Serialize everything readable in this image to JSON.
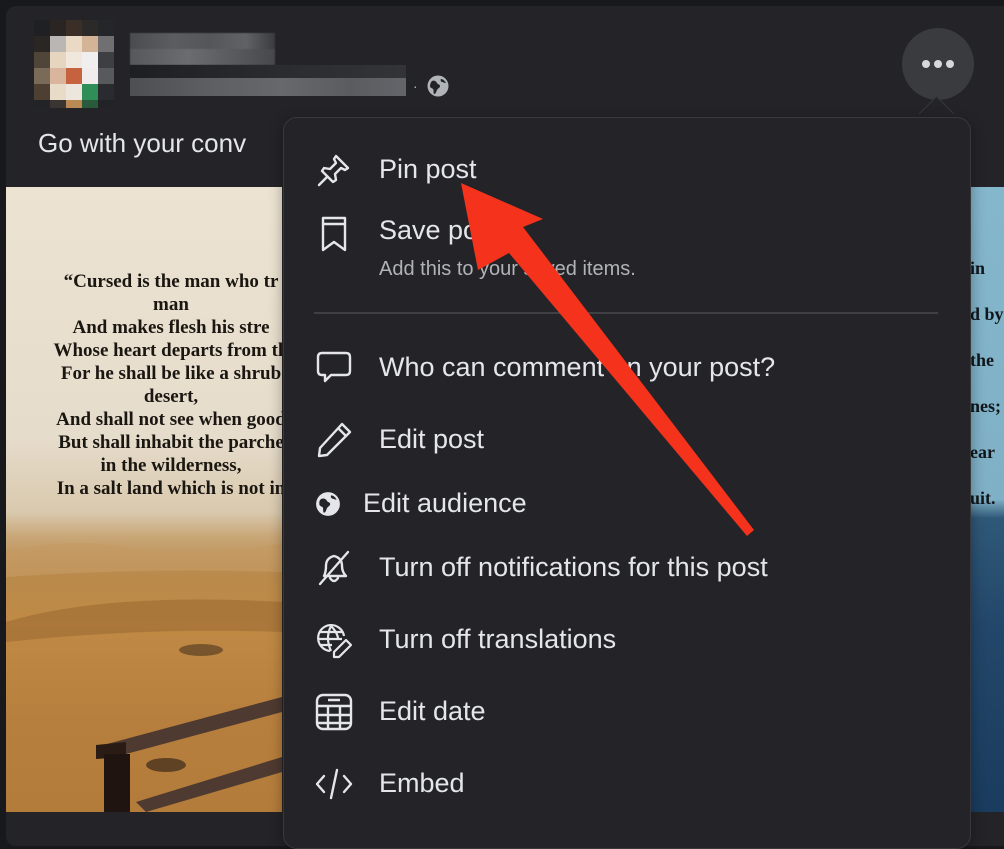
{
  "post": {
    "author_name": "[redacted name]",
    "privacy_icon": "globe-icon",
    "text_visible": "Go with your conv",
    "more_button_icon": "more-horizontal-icon"
  },
  "photo_left": {
    "poem_lines": [
      "“Cursed is the man who tr",
      "man",
      "And makes flesh his stre",
      "Whose heart departs from th",
      "For he shall be like a shrub",
      "desert,",
      "And shall not see when good",
      "But shall inhabit the parche",
      "in the wilderness,",
      "In a salt land which is not in"
    ]
  },
  "photo_right": {
    "poem_fragments": [
      "in",
      "d by",
      "the",
      "nes;",
      "ear",
      "uit."
    ]
  },
  "menu": {
    "items": [
      {
        "label": "Pin post",
        "icon": "pin-icon"
      },
      {
        "label": "Save post",
        "sublabel": "Add this to your saved items.",
        "icon": "bookmark-icon"
      },
      {
        "label": "Who can comment on your post?",
        "icon": "comment-bubble-icon"
      },
      {
        "label": "Edit post",
        "icon": "pencil-icon"
      },
      {
        "label": "Edit audience",
        "icon": "globe-icon"
      },
      {
        "label": "Turn off notifications for this post",
        "icon": "bell-off-icon"
      },
      {
        "label": "Turn off translations",
        "icon": "globe-pencil-icon"
      },
      {
        "label": "Edit date",
        "icon": "calendar-icon"
      },
      {
        "label": "Embed",
        "icon": "code-icon"
      }
    ]
  },
  "annotation": {
    "type": "arrow",
    "color": "#f5321c",
    "points_to": "Pin post"
  },
  "colors": {
    "background": "#18191c",
    "card": "#242428",
    "text_primary": "#e4e6eb",
    "text_secondary": "#b0b3b8",
    "annotation": "#f5321c"
  }
}
